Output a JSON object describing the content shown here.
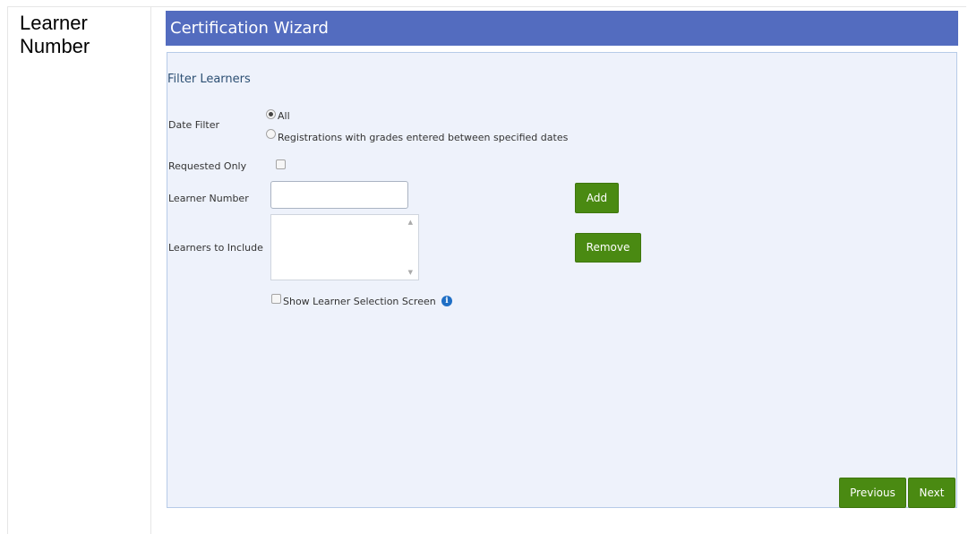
{
  "side_panel": {
    "label": "Learner Number"
  },
  "wizard": {
    "title": "Certification Wizard",
    "section_title": "Filter Learners",
    "date_filter": {
      "label": "Date Filter",
      "options": [
        {
          "label": "All",
          "selected": true
        },
        {
          "label": "Registrations with grades entered between specified dates",
          "selected": false
        }
      ]
    },
    "requested_only": {
      "label": "Requested Only",
      "checked": false
    },
    "learner_number": {
      "label": "Learner Number",
      "value": ""
    },
    "learners_to_include": {
      "label": "Learners to Include",
      "items": []
    },
    "show_selection": {
      "label": "Show Learner Selection Screen",
      "checked": false,
      "icon": "info-icon"
    },
    "buttons": {
      "add": "Add",
      "remove": "Remove",
      "previous": "Previous",
      "next": "Next"
    }
  },
  "colors": {
    "header_bg": "#536cbf",
    "body_bg": "#eef2fb",
    "button_green": "#4a8a12"
  }
}
